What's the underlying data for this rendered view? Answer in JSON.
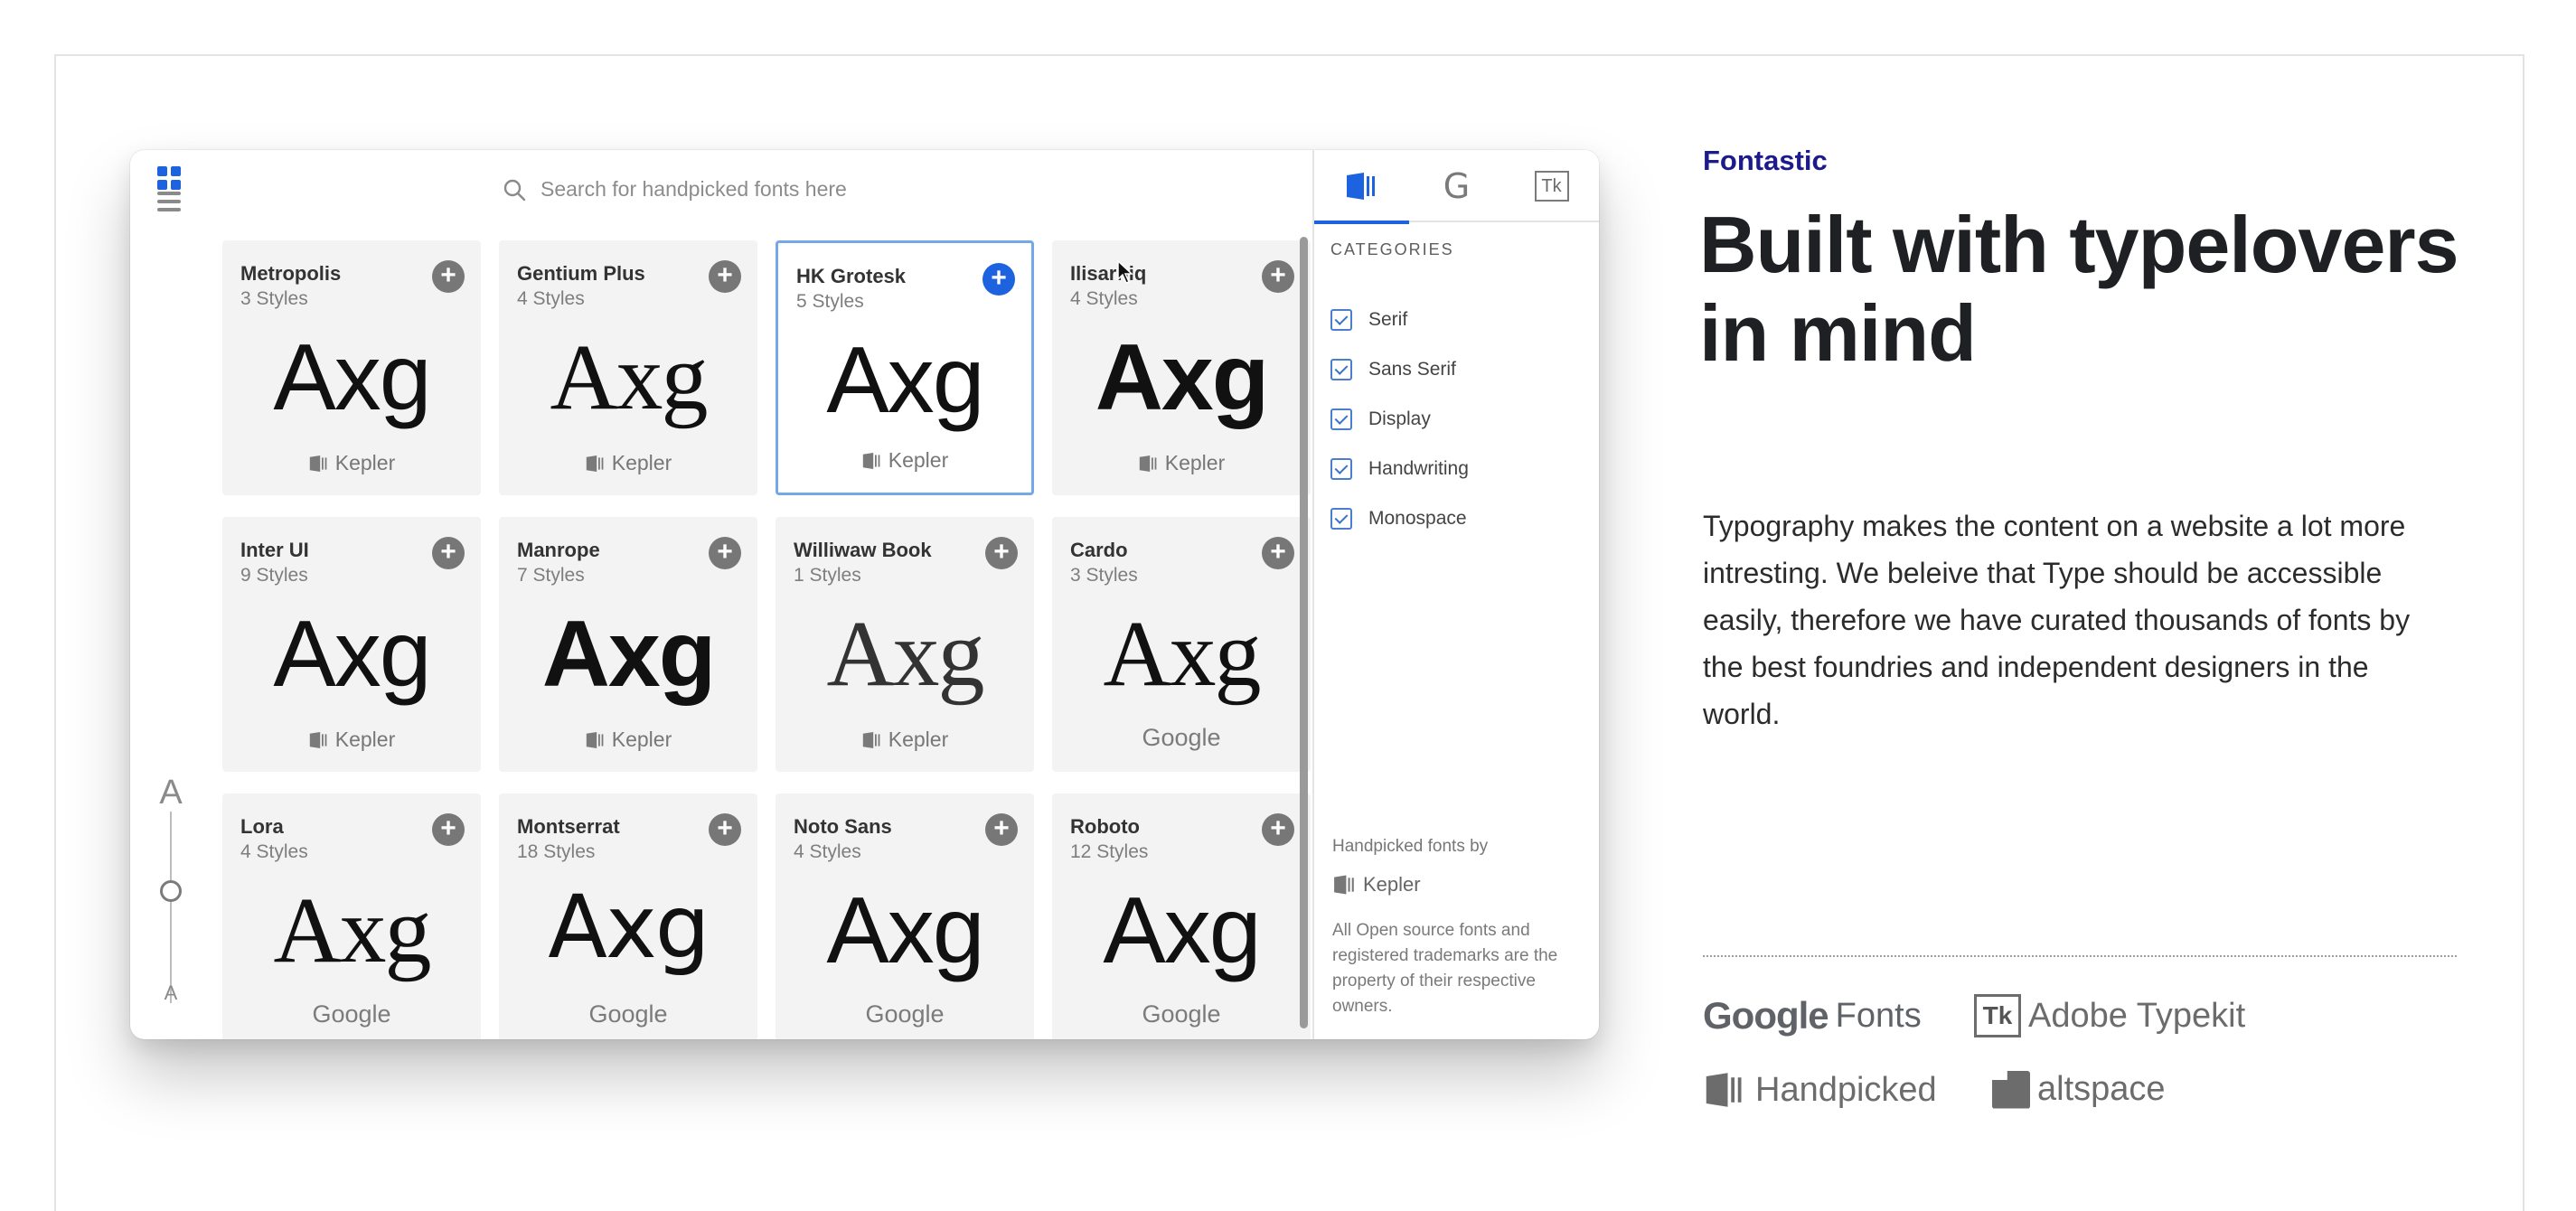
{
  "app": {
    "search_placeholder": "Search for handpicked fonts here",
    "sample_text": "Axg",
    "fonts": [
      {
        "name": "Metropolis",
        "styles": "3 Styles",
        "foundry": "Kepler",
        "style": "f-sans"
      },
      {
        "name": "Gentium Plus",
        "styles": "4 Styles",
        "foundry": "Kepler",
        "style": "f-serif"
      },
      {
        "name": "HK Grotesk",
        "styles": "5 Styles",
        "foundry": "Kepler",
        "style": "f-sans",
        "selected": true
      },
      {
        "name": "Ilisarniq",
        "styles": "4 Styles",
        "foundry": "Kepler",
        "style": "f-sans-bold"
      },
      {
        "name": "Inter UI",
        "styles": "9 Styles",
        "foundry": "Kepler",
        "style": "f-sans"
      },
      {
        "name": "Manrope",
        "styles": "7 Styles",
        "foundry": "Kepler",
        "style": "f-sans-bold"
      },
      {
        "name": "Williwaw Book",
        "styles": "1 Styles",
        "foundry": "Kepler",
        "style": "f-serif-light"
      },
      {
        "name": "Cardo",
        "styles": "3 Styles",
        "foundry": "Google",
        "style": "f-serif"
      },
      {
        "name": "Lora",
        "styles": "4 Styles",
        "foundry": "Google",
        "style": "f-serif"
      },
      {
        "name": "Montserrat",
        "styles": "18 Styles",
        "foundry": "Google",
        "style": "f-dejavu"
      },
      {
        "name": "Noto Sans",
        "styles": "4 Styles",
        "foundry": "Google",
        "style": "f-sans"
      },
      {
        "name": "Roboto",
        "styles": "12 Styles",
        "foundry": "Google",
        "style": "f-sans"
      }
    ],
    "size_slider": {
      "large_label": "A",
      "small_label": "A"
    },
    "panel": {
      "tabs": [
        {
          "icon": "kepler-icon",
          "active": true
        },
        {
          "label": "G"
        },
        {
          "label": "Tk"
        }
      ],
      "categories_title": "CATEGORIES",
      "categories": [
        "Serif",
        "Sans Serif",
        "Display",
        "Handwriting",
        "Monospace"
      ],
      "handpicked_title": "Handpicked fonts by",
      "handpicked_brand": "Kepler",
      "note": "All Open source fonts and registered trademarks are the property of their respective owners."
    }
  },
  "copy": {
    "brand": "Fontastic",
    "headline": "Built with typelovers in mind",
    "body": "Typography makes the content on a website a lot more intresting. We beleive that Type should be accessible easily, therefore we have curated thousands of fonts by the best foundries and independent designers in the world."
  },
  "partners": {
    "google": {
      "word": "Google",
      "suffix": "Fonts"
    },
    "typekit": {
      "badge": "Tk",
      "name": "Adobe Typekit"
    },
    "handpicked": {
      "name": "Handpicked"
    },
    "altspace": {
      "name": "altspace"
    }
  },
  "colors": {
    "accent": "#1d63e0",
    "brand": "#1d1b8a",
    "card": "#f3f3f3"
  }
}
